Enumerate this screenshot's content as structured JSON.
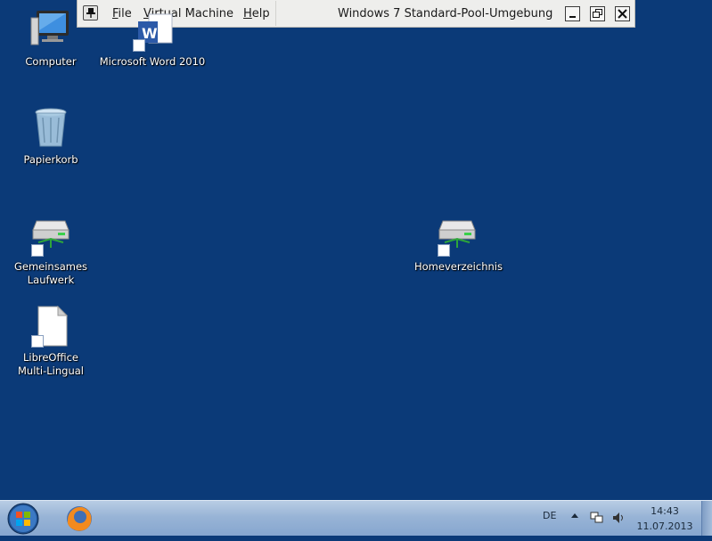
{
  "toolbar": {
    "menu": [
      {
        "mnemonic": "F",
        "rest": "ile"
      },
      {
        "mnemonic": "V",
        "rest": "irtual Machine"
      },
      {
        "mnemonic": "H",
        "rest": "elp"
      }
    ],
    "title": "Windows 7 Standard-Pool-Umgebung",
    "icons": [
      "pin-icon",
      "minimize-icon",
      "restore-icon",
      "close-icon"
    ]
  },
  "desktop": {
    "icons": [
      {
        "name": "computer",
        "label": "Computer"
      },
      {
        "name": "microsoft-word-2010",
        "label": "Microsoft Word 2010"
      },
      {
        "name": "papierkorb",
        "label": "Papierkorb"
      },
      {
        "name": "gemeinsames-laufwerk",
        "label_line1": "Gemeinsames",
        "label_line2": "Laufwerk"
      },
      {
        "name": "homeverzeichnis",
        "label": "Homeverzeichnis"
      },
      {
        "name": "libreoffice",
        "label_line1": "LibreOffice",
        "label_line2": "Multi-Lingual"
      }
    ]
  },
  "taskbar": {
    "language": "DE",
    "time": "14:43",
    "date": "11.07.2013",
    "colors": {
      "desktop_bg": "#0b3a78",
      "taskbar": "#98b4d6"
    }
  }
}
